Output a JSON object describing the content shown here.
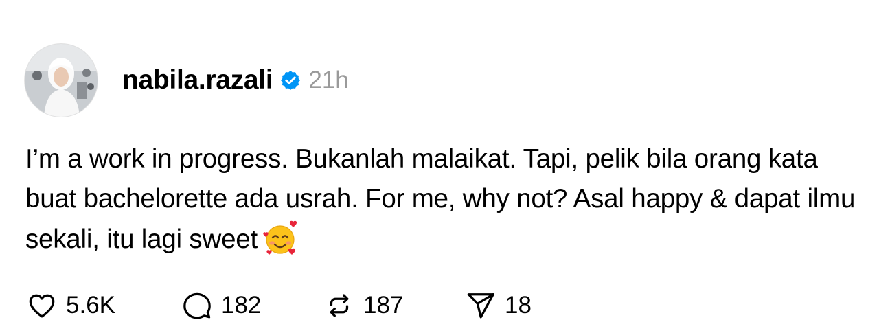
{
  "post": {
    "username": "nabila.razali",
    "time": "21h",
    "text": "I’m a work in progress. Bukanlah malaikat. Tapi, pelik bila orang kata buat bachelorette ada usrah. For me, why not? Asal happy & dapat ilmu sekali, itu lagi sweet",
    "emoji": "smiling-face-with-hearts"
  },
  "actions": {
    "likes": "5.6K",
    "comments": "182",
    "reposts": "187",
    "shares": "18"
  },
  "colors": {
    "verified": "#0095f6",
    "timestamp": "#9a9a9a",
    "text": "#000000"
  },
  "icons": {
    "like": "heart-icon",
    "comment": "comment-bubble-icon",
    "repost": "repost-icon",
    "share": "send-icon",
    "verified": "verified-badge-icon"
  }
}
